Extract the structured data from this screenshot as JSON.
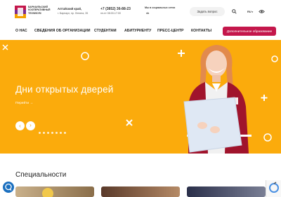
{
  "header": {
    "logo_lines": [
      "БАРНАУЛЬСКИЙ",
      "КООПЕРАТИВНЫЙ",
      "ТЕХНИКУМ"
    ],
    "region": "Алтайский край,",
    "address": "г. Барнаул, пр. Ленина, 35",
    "phone": "+7 (3852) 36-88-23",
    "hours": "пн-пт 08:00-17:00",
    "social_label": "Мы в социальных сетях",
    "social_vk": "vk",
    "ask_button": "Задать вопрос",
    "lang": "RU"
  },
  "nav": {
    "items": [
      "О НАС",
      "СВЕДЕНИЯ ОБ ОРГАНИЗАЦИИ",
      "СТУДЕНТАМ",
      "АБИТУРИЕНТУ",
      "ПРЕСС-ЦЕНТР",
      "КОНТАКТЫ"
    ],
    "extra_button": "Дополнительное образование"
  },
  "banner": {
    "title": "Дни открытых дверей",
    "link": "Перейти",
    "bg_color": "#fbab0c",
    "slides_count": 7
  },
  "section": {
    "title": "Специальности"
  },
  "colors": {
    "accent": "#c4174b",
    "banner": "#fbab0c",
    "chat": "#1a6fbf"
  }
}
